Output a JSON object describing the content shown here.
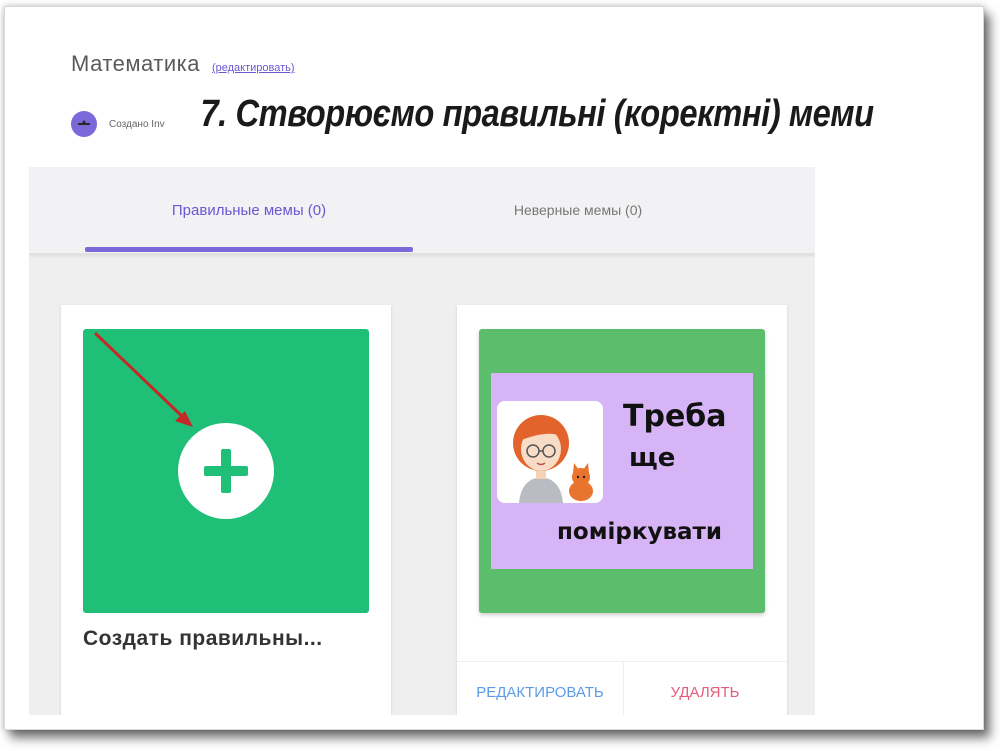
{
  "header": {
    "set_title": "Математика",
    "edit_link": "(редактировать)",
    "creator_text": "Создано Inv"
  },
  "slide": {
    "heading": "7. Створюємо правильні (коректні) меми"
  },
  "tabs": [
    {
      "label": "Правильные мемы (0)",
      "active": true
    },
    {
      "label": "Неверные мемы (0)",
      "active": false
    }
  ],
  "create_card": {
    "label": "Создать правильны..."
  },
  "meme_card": {
    "text_line1": "Треба",
    "text_line2": "ще",
    "text_line3": "поміркувати",
    "edit_label": "РЕДАКТИРОВАТЬ",
    "delete_label": "УДАЛЯТЬ"
  },
  "colors": {
    "accent": "#7b68d9",
    "create_tile": "#1fbf78",
    "meme_tile": "#5cbd6c",
    "meme_bg": "#d6b4f5",
    "edit": "#5b9be6",
    "delete": "#e65a7a"
  }
}
